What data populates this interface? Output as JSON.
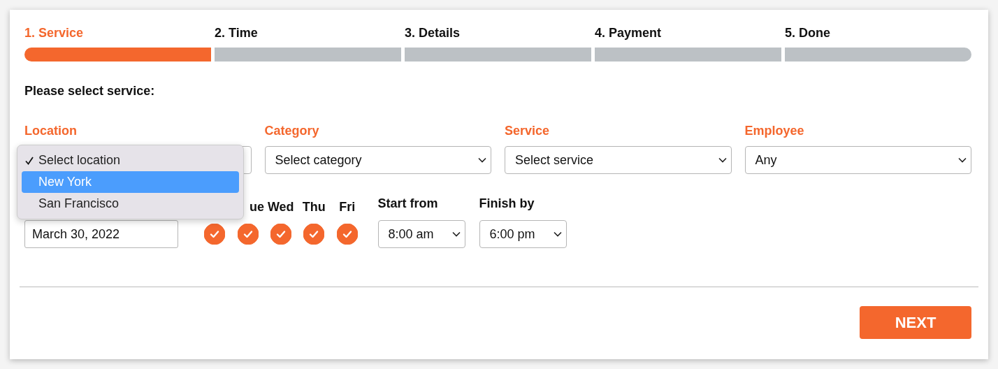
{
  "steps": [
    {
      "label": "1. Service",
      "selected": true
    },
    {
      "label": "2. Time",
      "selected": false
    },
    {
      "label": "3. Details",
      "selected": false
    },
    {
      "label": "4. Payment",
      "selected": false
    },
    {
      "label": "5. Done",
      "selected": false
    }
  ],
  "heading": "Please select service:",
  "filters": [
    {
      "label": "Location"
    },
    {
      "label": "Category",
      "value": "Select category"
    },
    {
      "label": "Service",
      "value": "Select service"
    },
    {
      "label": "Employee",
      "value": "Any"
    }
  ],
  "location_menu": {
    "options": [
      {
        "label": "Select location",
        "checked": true,
        "selected": false
      },
      {
        "label": "New York",
        "checked": false,
        "selected": true
      },
      {
        "label": "San Francisco",
        "checked": false,
        "selected": false
      }
    ]
  },
  "date": {
    "value": "March 30, 2022"
  },
  "days": [
    {
      "checked": true
    },
    {
      "label": "ue",
      "checked": true
    },
    {
      "label": "Wed",
      "checked": true
    },
    {
      "label": "Thu",
      "checked": true
    },
    {
      "label": "Fri",
      "checked": true
    }
  ],
  "start": {
    "label": "Start from",
    "value": "8:00 am"
  },
  "finish": {
    "label": "Finish by",
    "value": "6:00 pm"
  },
  "next_button": "NEXT"
}
